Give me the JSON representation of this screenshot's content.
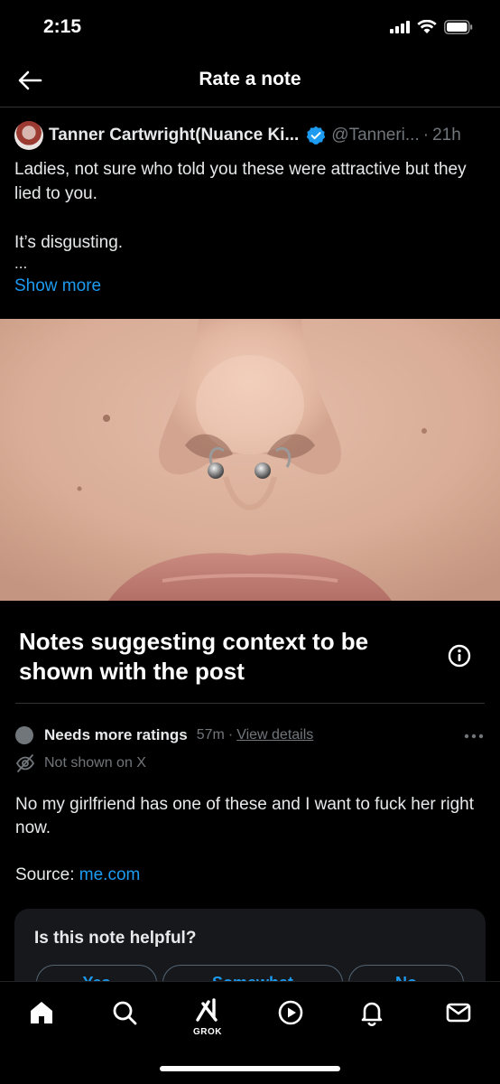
{
  "status_bar": {
    "time": "2:15"
  },
  "header": {
    "title": "Rate a note",
    "back_icon": "arrow-left-icon"
  },
  "post": {
    "author": "Tanner Cartwright(Nuance Ki...",
    "handle": "@Tanneri...",
    "separator": "·",
    "time": "21h",
    "text_line1": "Ladies, not sure who told you these were attractive but they lied to you.",
    "text_line2": "It’s disgusting.",
    "ellipsis": "...",
    "show_more": "Show more"
  },
  "notes": {
    "heading": "Notes suggesting context to be shown with the post",
    "note": {
      "status": "Needs more ratings",
      "age": "57m",
      "separator": "·",
      "view_details": "View details",
      "visibility": "Not shown on X",
      "body": "No my girlfriend has one of these and I want to fuck her right now.",
      "source_label": "Source:",
      "source_link": "me.com"
    },
    "rating": {
      "question": "Is this note helpful?",
      "options": [
        "Yes",
        "Somewhat",
        "No"
      ]
    }
  },
  "tabbar": {
    "grok_label": "GROK",
    "tabs": [
      "home-icon",
      "search-icon",
      "grok-icon",
      "video-icon",
      "notifications-icon",
      "messages-icon"
    ]
  },
  "colors": {
    "accent": "#1d9bf0",
    "muted": "#71767b",
    "background": "#000000",
    "card": "#16181c"
  }
}
